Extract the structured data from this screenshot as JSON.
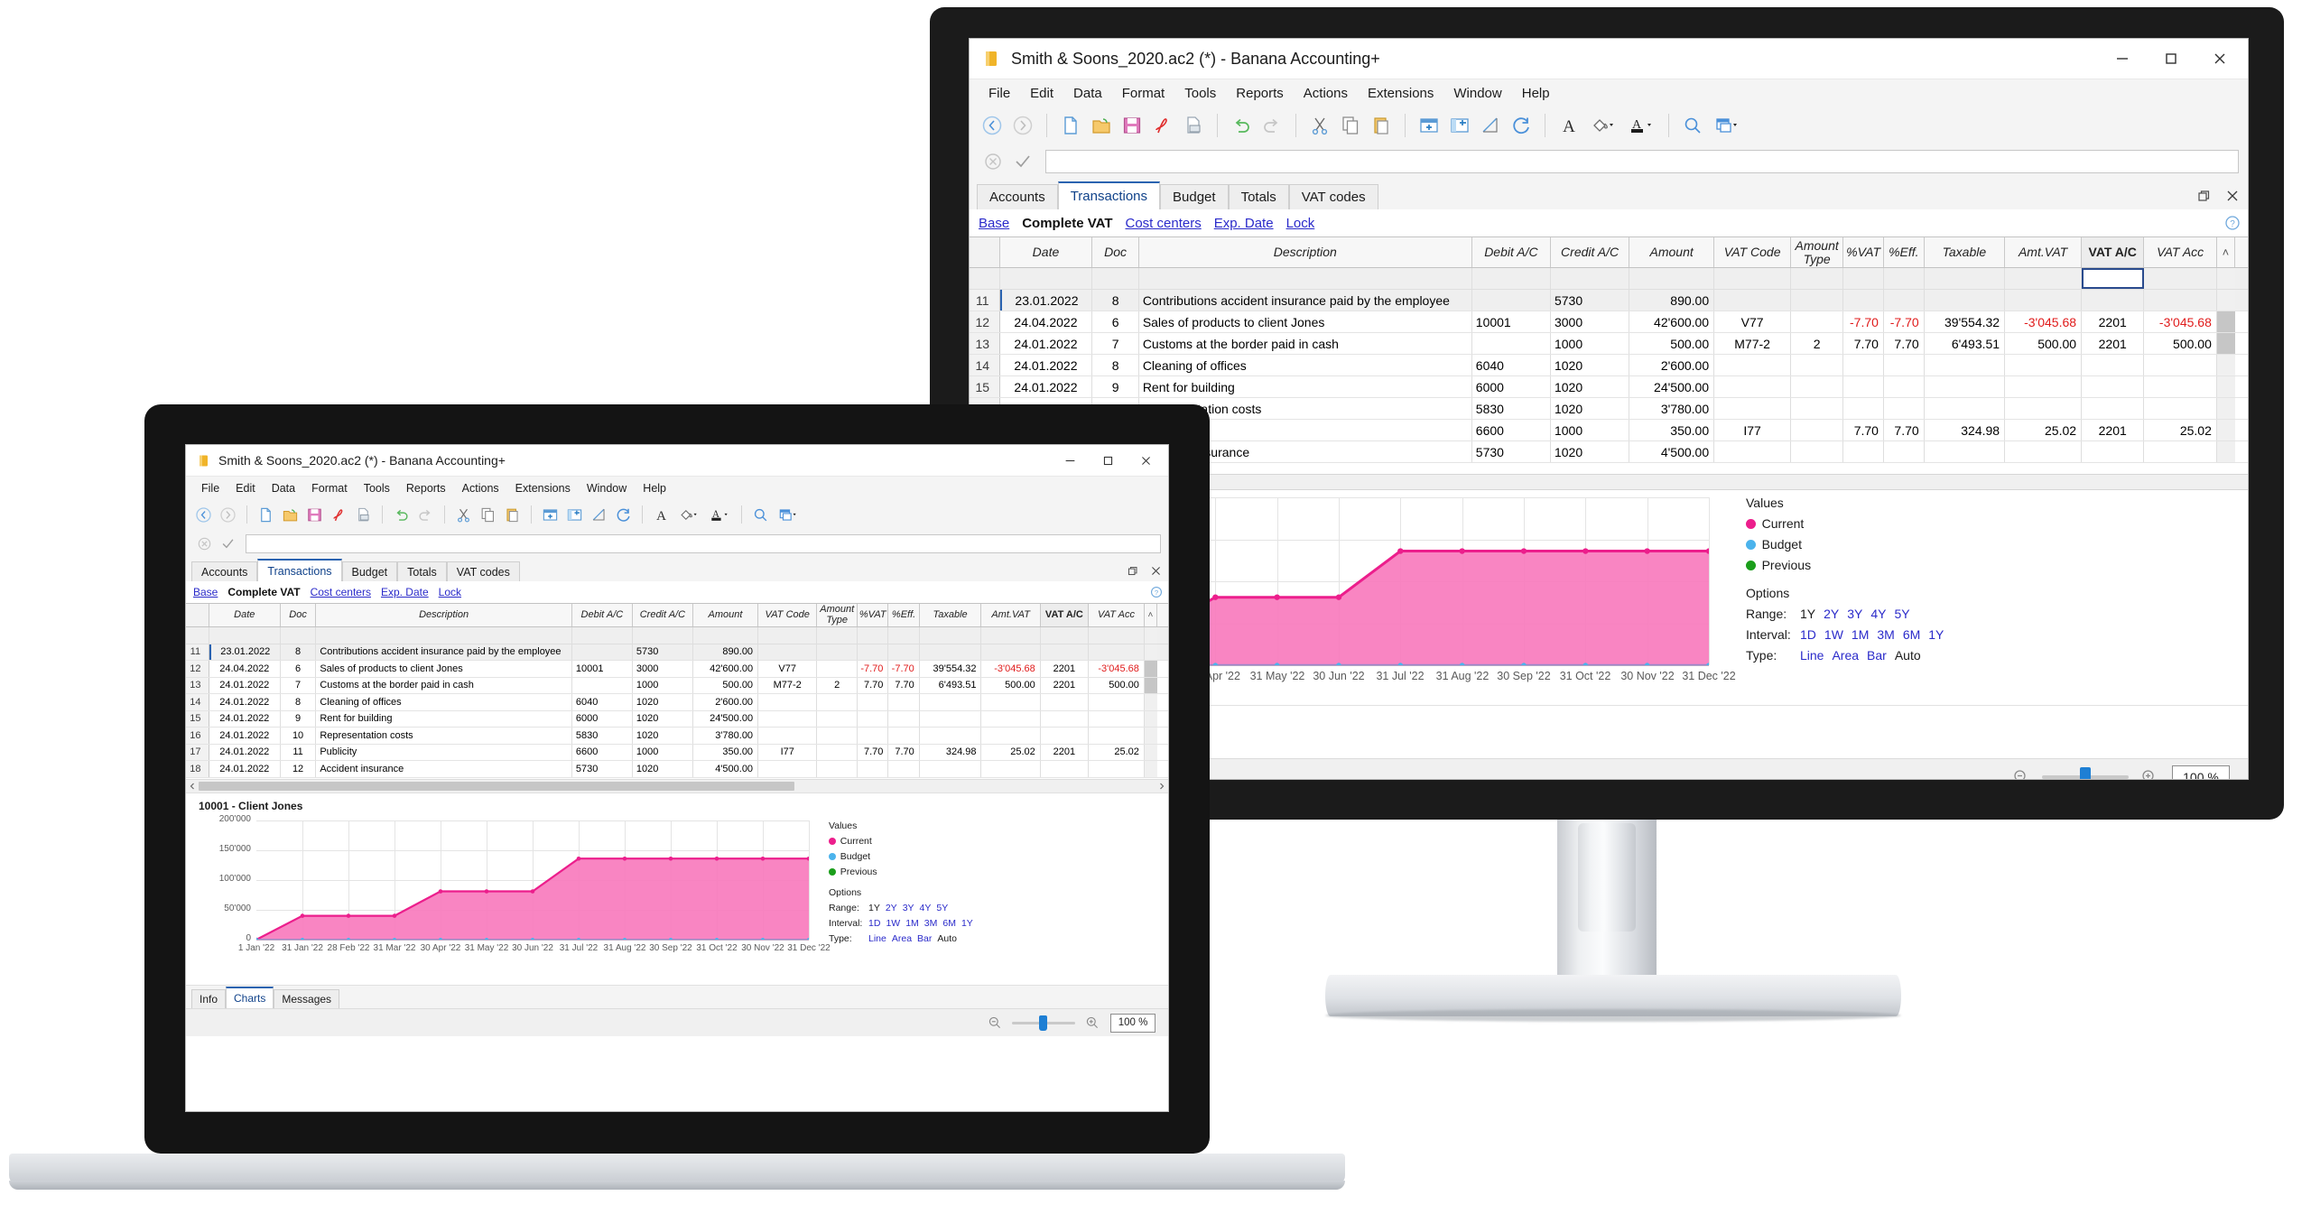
{
  "app": {
    "title": "Smith & Soons_2020.ac2 (*) - Banana Accounting+",
    "menus": [
      "File",
      "Edit",
      "Data",
      "Format",
      "Tools",
      "Reports",
      "Actions",
      "Extensions",
      "Window",
      "Help"
    ],
    "window_controls": {
      "minimize": "–",
      "maximize": "☐",
      "close": "✕"
    },
    "toolbar_icons": [
      "back-icon",
      "forward-icon",
      "new-file-icon",
      "open-folder-icon",
      "save-icon",
      "export-pdf-icon",
      "print-preview-icon",
      "undo-icon",
      "redo-icon",
      "cut-icon",
      "copy-icon",
      "paste-icon",
      "add-row-icon",
      "add-column-icon",
      "sort-icon",
      "recalculate-icon",
      "font-icon",
      "fill-color-icon",
      "text-color-icon",
      "search-icon",
      "window-layout-icon"
    ],
    "formula_bar": {
      "value": "",
      "placeholder": "",
      "cancel_icon": "cancel-icon",
      "accept_icon": "accept-icon"
    },
    "tabs": [
      {
        "label": "Accounts",
        "selected": false
      },
      {
        "label": "Transactions",
        "selected": true
      },
      {
        "label": "Budget",
        "selected": false
      },
      {
        "label": "Totals",
        "selected": false
      },
      {
        "label": "VAT codes",
        "selected": false
      }
    ],
    "view_links": [
      {
        "label": "Base",
        "current": false
      },
      {
        "label": "Complete VAT",
        "current": true
      },
      {
        "label": "Cost centers",
        "current": false
      },
      {
        "label": "Exp. Date",
        "current": false
      },
      {
        "label": "Lock",
        "current": false
      }
    ],
    "panel_icons": {
      "restore": "restore-panel-icon",
      "close": "close-panel-icon",
      "help": "help-icon"
    },
    "bottom_tabs": [
      {
        "label": "Info",
        "selected": false
      },
      {
        "label": "Charts",
        "selected": true
      },
      {
        "label": "Messages",
        "selected": false
      }
    ],
    "status": {
      "zoom_out_icon": "zoom-out-icon",
      "zoom_in_icon": "zoom-in-icon",
      "zoom_value": "100 %"
    }
  },
  "table": {
    "columns": [
      "Date",
      "Doc",
      "Description",
      "Debit A/C",
      "Credit A/C",
      "Amount",
      "VAT Code",
      "Amount Type",
      "%VAT",
      "%Eff.",
      "Taxable",
      "Amt.VAT",
      "VAT A/C",
      "VAT Acc"
    ],
    "column_header_lines": {
      "amount_type_1": "Amount",
      "amount_type_2": "Type"
    },
    "selected_column": "VAT A/C",
    "rows": [
      {
        "no": "11",
        "date": "23.01.2022",
        "doc": "8",
        "desc": "Contributions accident insurance paid by the employee",
        "debit": "",
        "credit": "5730",
        "amount": "890.00",
        "vatcode": "",
        "amounttype": "",
        "pvat": "",
        "peff": "",
        "taxable": "",
        "amtvat": "",
        "vatac": "",
        "vatacc": "",
        "selected": true
      },
      {
        "no": "12",
        "date": "24.04.2022",
        "doc": "6",
        "desc": "Sales of products to client Jones",
        "debit": "10001",
        "credit": "3000",
        "amount": "42'600.00",
        "vatcode": "V77",
        "amounttype": "",
        "pvat": "-7.70",
        "peff": "-7.70",
        "taxable": "39'554.32",
        "amtvat": "-3'045.68",
        "vatac": "2201",
        "vatacc": "-3'045.68",
        "selected": false
      },
      {
        "no": "13",
        "date": "24.01.2022",
        "doc": "7",
        "desc": "Customs at the border paid in cash",
        "debit": "",
        "credit": "1000",
        "amount": "500.00",
        "vatcode": "M77-2",
        "amounttype": "2",
        "pvat": "7.70",
        "peff": "7.70",
        "taxable": "6'493.51",
        "amtvat": "500.00",
        "vatac": "2201",
        "vatacc": "500.00",
        "selected": false
      },
      {
        "no": "14",
        "date": "24.01.2022",
        "doc": "8",
        "desc": "Cleaning of offices",
        "debit": "6040",
        "credit": "1020",
        "amount": "2'600.00",
        "vatcode": "",
        "amounttype": "",
        "pvat": "",
        "peff": "",
        "taxable": "",
        "amtvat": "",
        "vatac": "",
        "vatacc": "",
        "selected": false
      },
      {
        "no": "15",
        "date": "24.01.2022",
        "doc": "9",
        "desc": "Rent for building",
        "debit": "6000",
        "credit": "1020",
        "amount": "24'500.00",
        "vatcode": "",
        "amounttype": "",
        "pvat": "",
        "peff": "",
        "taxable": "",
        "amtvat": "",
        "vatac": "",
        "vatacc": "",
        "selected": false
      },
      {
        "no": "16",
        "date": "24.01.2022",
        "doc": "10",
        "desc": "Representation costs",
        "debit": "5830",
        "credit": "1020",
        "amount": "3'780.00",
        "vatcode": "",
        "amounttype": "",
        "pvat": "",
        "peff": "",
        "taxable": "",
        "amtvat": "",
        "vatac": "",
        "vatacc": "",
        "selected": false
      },
      {
        "no": "17",
        "date": "24.01.2022",
        "doc": "11",
        "desc": "Publicity",
        "debit": "6600",
        "credit": "1000",
        "amount": "350.00",
        "vatcode": "I77",
        "amounttype": "",
        "pvat": "7.70",
        "peff": "7.70",
        "taxable": "324.98",
        "amtvat": "25.02",
        "vatac": "2201",
        "vatacc": "25.02",
        "selected": false
      },
      {
        "no": "18",
        "date": "24.01.2022",
        "doc": "12",
        "desc": "Accident insurance",
        "debit": "5730",
        "credit": "1020",
        "amount": "4'500.00",
        "vatcode": "",
        "amounttype": "",
        "pvat": "",
        "peff": "",
        "taxable": "",
        "amtvat": "",
        "vatac": "",
        "vatacc": "",
        "selected": false
      }
    ]
  },
  "chart_data": {
    "type": "area",
    "title": "10001 - Client Jones",
    "xlabel": "",
    "ylabel": "",
    "ylim": [
      0,
      200000
    ],
    "yticks": [
      "0",
      "50'000",
      "100'000",
      "150'000",
      "200'000"
    ],
    "ytick_values": [
      0,
      50000,
      100000,
      150000,
      200000
    ],
    "grid": true,
    "categories": [
      "1 Jan '22",
      "31 Jan '22",
      "28 Feb '22",
      "31 Mar '22",
      "30 Apr '22",
      "31 May '22",
      "30 Jun '22",
      "31 Jul '22",
      "31 Aug '22",
      "30 Sep '22",
      "31 Oct '22",
      "30 Nov '22",
      "31 Dec '22"
    ],
    "series": [
      {
        "name": "Current",
        "color": "#ec1e8c",
        "values": [
          0,
          40000,
          40000,
          40000,
          81000,
          81000,
          81000,
          136000,
          136000,
          136000,
          136000,
          136000,
          136000
        ]
      },
      {
        "name": "Budget",
        "color": "#4bb3ec",
        "values": [
          0,
          0,
          0,
          0,
          0,
          0,
          0,
          0,
          0,
          0,
          0,
          0,
          0
        ]
      },
      {
        "name": "Previous",
        "color": "#1b9e1b",
        "values": [
          0,
          0,
          0,
          0,
          0,
          0,
          0,
          0,
          0,
          0,
          0,
          0,
          0
        ]
      }
    ],
    "legend_position": "right",
    "legend_title": "Values"
  },
  "chart_panel": {
    "values_label": "Values",
    "options_label": "Options",
    "legend": [
      {
        "label": "Current",
        "color": "#ec1e8c"
      },
      {
        "label": "Budget",
        "color": "#4bb3ec"
      },
      {
        "label": "Previous",
        "color": "#1b9e1b"
      }
    ],
    "range": {
      "label": "Range:",
      "options": [
        {
          "v": "1Y",
          "active": true
        },
        {
          "v": "2Y",
          "active": false
        },
        {
          "v": "3Y",
          "active": false
        },
        {
          "v": "4Y",
          "active": false
        },
        {
          "v": "5Y",
          "active": false
        }
      ]
    },
    "interval": {
      "label": "Interval:",
      "options": [
        {
          "v": "1D",
          "active": false
        },
        {
          "v": "1W",
          "active": false
        },
        {
          "v": "1M",
          "active": false
        },
        {
          "v": "3M",
          "active": false
        },
        {
          "v": "6M",
          "active": false
        },
        {
          "v": "1Y",
          "active": false
        }
      ]
    },
    "type": {
      "label": "Type:",
      "options": [
        {
          "v": "Line",
          "active": false
        },
        {
          "v": "Area",
          "active": false
        },
        {
          "v": "Bar",
          "active": false
        },
        {
          "v": "Auto",
          "active": true
        }
      ]
    }
  },
  "colors": {
    "accent_pink": "#ec1e8c",
    "area_fill": "#f97bbd",
    "link_blue": "#2a2aca",
    "tab_selected": "#2a63b0",
    "negative_red": "#e01b1b",
    "toolbar_bg": "#f4f4f4"
  }
}
